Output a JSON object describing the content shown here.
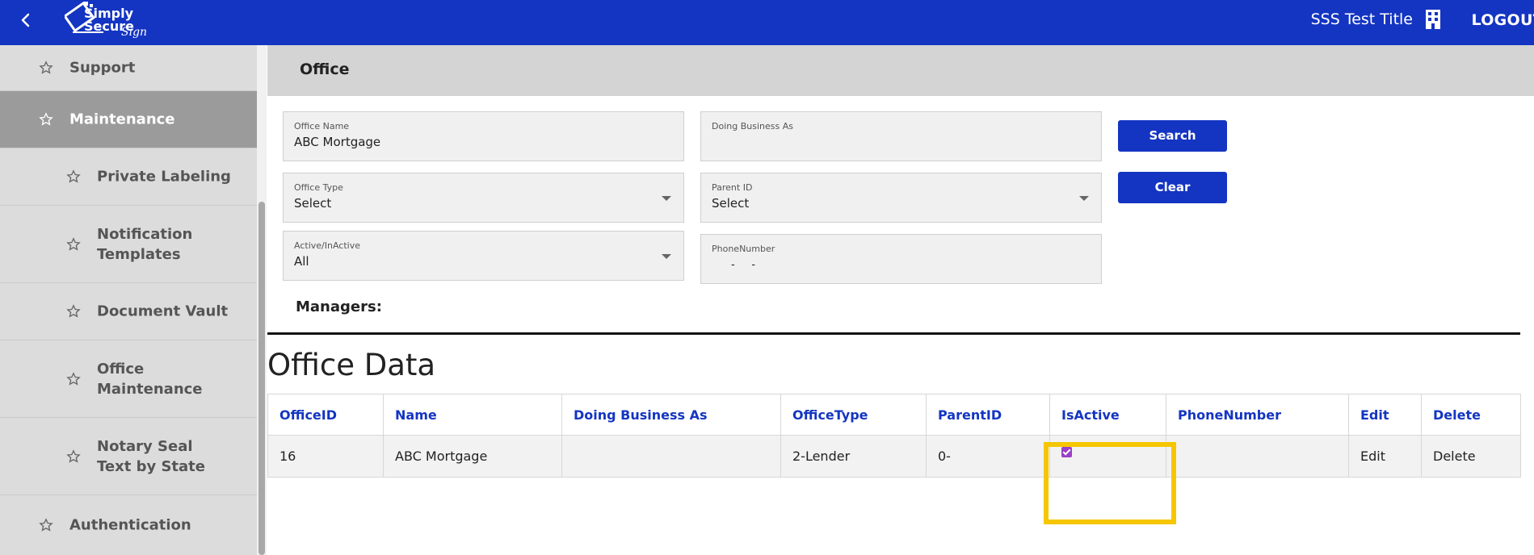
{
  "topbar": {
    "user": "SSS Test Title",
    "logout": "LOGOUT",
    "logo_text": "Simply Secure Sign"
  },
  "sidebar": {
    "items": [
      {
        "label": "Support"
      },
      {
        "label": "Maintenance"
      },
      {
        "label": "Private Labeling"
      },
      {
        "label": "Notification Templates"
      },
      {
        "label": "Document Vault"
      },
      {
        "label": "Office Maintenance"
      },
      {
        "label": "Notary Seal Text by State"
      },
      {
        "label": "Authentication"
      }
    ]
  },
  "page": {
    "title": "Office"
  },
  "form": {
    "office_name": {
      "label": "Office Name",
      "value": "ABC Mortgage"
    },
    "dba": {
      "label": "Doing Business As",
      "value": ""
    },
    "office_type": {
      "label": "Office Type",
      "value": "Select"
    },
    "parent_id": {
      "label": "Parent ID",
      "value": "Select"
    },
    "active": {
      "label": "Active/InActive",
      "value": "All"
    },
    "phone": {
      "label": "PhoneNumber",
      "value": "-     -"
    },
    "search_label": "Search",
    "clear_label": "Clear"
  },
  "managers_label": "Managers:",
  "data_title": "Office Data",
  "table": {
    "headers": [
      "OfficeID",
      "Name",
      "Doing Business As",
      "OfficeType",
      "ParentID",
      "IsActive",
      "PhoneNumber",
      "Edit",
      "Delete"
    ],
    "rows": [
      {
        "office_id": "16",
        "name": "ABC Mortgage",
        "dba": "",
        "office_type": "2-Lender",
        "parent_id": "0-",
        "is_active": true,
        "phone": "",
        "edit": "Edit",
        "delete": "Delete"
      }
    ]
  },
  "colors": {
    "brand": "#1435c2",
    "highlight": "#f6c600",
    "checkbox": "#9b3fc6"
  },
  "icons": [
    "back-arrow-icon",
    "building-icon",
    "star-icon",
    "chevron-down-icon"
  ]
}
